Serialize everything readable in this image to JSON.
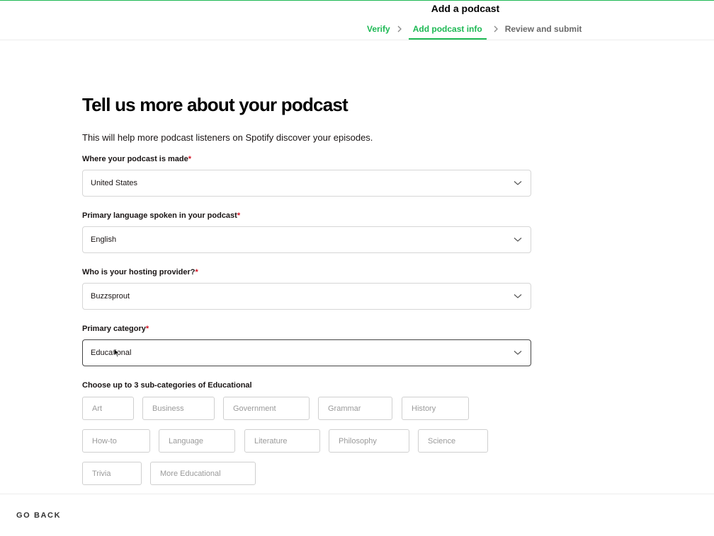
{
  "header": {
    "title": "Add a podcast",
    "steps": [
      {
        "label": "Verify",
        "state": "done"
      },
      {
        "label": "Add podcast info",
        "state": "active"
      },
      {
        "label": "Review and submit",
        "state": "pending"
      }
    ]
  },
  "main": {
    "title": "Tell us more about your podcast",
    "subtitle": "This will help more podcast listeners on Spotify discover your episodes.",
    "fields": [
      {
        "label": "Where your podcast is made",
        "required_mark": "*",
        "value": "United States"
      },
      {
        "label": "Primary language spoken in your podcast",
        "required_mark": "*",
        "value": "English"
      },
      {
        "label": "Who is your hosting provider?",
        "required_mark": "*",
        "value": "Buzzsprout"
      },
      {
        "label": "Primary category",
        "required_mark": "*",
        "value": "Educational"
      }
    ],
    "subcategories_label": "Choose up to 3 sub-categories of Educational",
    "subcategories": [
      "Art",
      "Business",
      "Government",
      "Grammar",
      "History",
      "How-to",
      "Language",
      "Literature",
      "Philosophy",
      "Science",
      "Trivia",
      "More Educational"
    ]
  },
  "footer": {
    "back_label": "GO BACK"
  },
  "colors": {
    "accent": "#1db954",
    "required": "#d31425"
  },
  "icons": {
    "step_separator": "chevron-right-icon",
    "select_arrow": "chevron-down-icon",
    "pointer": "mouse-cursor-icon"
  }
}
